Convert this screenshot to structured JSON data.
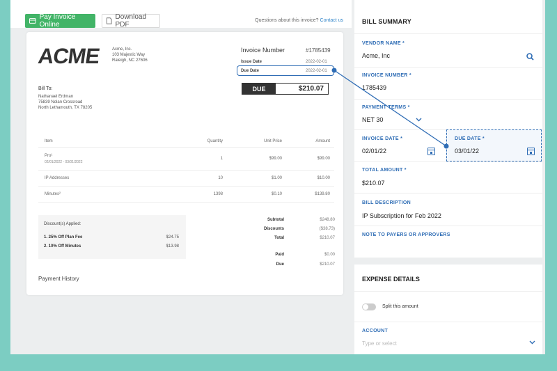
{
  "colors": {
    "background": "#7ccdc2",
    "accent": "#2f6db5",
    "pay_button": "#42b467"
  },
  "toolbar": {
    "pay_label": "Pay Invoice Online",
    "pdf_label": "Download PDF",
    "questions_text": "Questions about this invoice?",
    "contact_link": "Contact us"
  },
  "invoice": {
    "logo": "ACME",
    "company_lines": [
      "Acme, Inc.",
      "103 Majestic Way",
      "Raleigh, NC 27606"
    ],
    "number_label": "Invoice Number",
    "number_value": "#1785439",
    "issue_label": "Issue Date",
    "issue_value": "2022-02-01",
    "due_label": "Due Date",
    "due_value": "2022-02-01",
    "due_badge": "DUE",
    "due_amount": "$210.07",
    "bill_to_label": "Bill To:",
    "bill_to_lines": [
      "Nathanael Erdman",
      "75839 Nolan Crossroad",
      "North Lethamouth, TX 78205"
    ],
    "columns": [
      "Item",
      "Quantity",
      "Unit Price",
      "Amount"
    ],
    "rows": [
      {
        "item": "Pro¹",
        "sub": "02/01/2022 - 03/01/2022",
        "qty": "1",
        "unit": "$99.00",
        "amount": "$99.00"
      },
      {
        "item": "IP Addresses",
        "sub": "",
        "qty": "10",
        "unit": "$1.00",
        "amount": "$10.00"
      },
      {
        "item": "Minutes²",
        "sub": "",
        "qty": "1398",
        "unit": "$0.10",
        "amount": "$139.80"
      }
    ],
    "discount_title": "Discount(s) Applied:",
    "discounts": [
      {
        "label": "1. 25% Off Plan Fee",
        "amount": "$24.75"
      },
      {
        "label": "2. 10% Off Minutes",
        "amount": "$13.98"
      }
    ],
    "totals": {
      "subtotal_label": "Subtotal",
      "subtotal": "$248.80",
      "discounts_label": "Discounts",
      "discounts": "($38.73)",
      "total_label": "Total",
      "total": "$210.07",
      "paid_label": "Paid",
      "paid": "$0.00",
      "due_label": "Due",
      "due": "$210.07"
    },
    "payment_history": "Payment History"
  },
  "bill_summary": {
    "title": "BILL SUMMARY",
    "vendor_label": "VENDOR NAME *",
    "vendor_value": "Acme, Inc",
    "invoice_number_label": "INVOICE NUMBER *",
    "invoice_number_value": "1785439",
    "payment_terms_label": "PAYMENT TERMS *",
    "payment_terms_value": "NET 30",
    "invoice_date_label": "INVOICE DATE *",
    "invoice_date_value": "02/01/22",
    "due_date_label": "DUE DATE *",
    "due_date_value": "03/01/22",
    "total_amount_label": "TOTAL AMOUNT *",
    "total_amount_value": "$210.07",
    "description_label": "BILL DESCRIPTION",
    "description_value": "IP Subscription for Feb 2022",
    "note_label": "NOTE TO PAYERS OR APPROVERS"
  },
  "expense": {
    "title": "EXPENSE DETAILS",
    "split_label": "Split this amount",
    "split_on": false,
    "account_label": "ACCOUNT",
    "account_placeholder": "Type or select"
  }
}
